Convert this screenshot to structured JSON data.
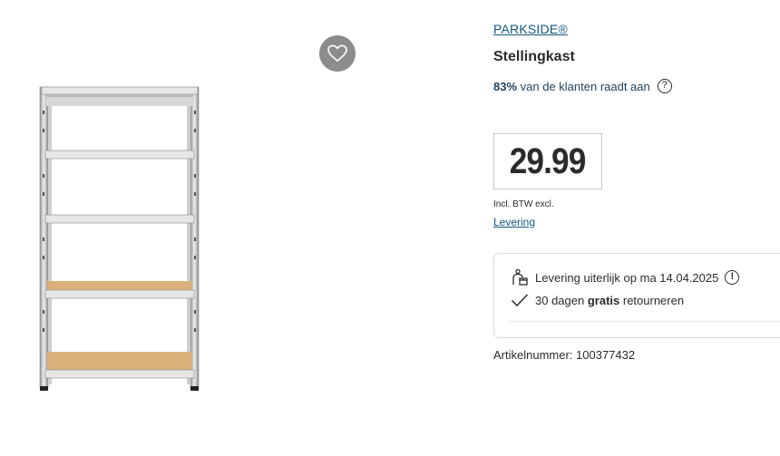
{
  "product": {
    "brand": "PARKSIDE®",
    "title": "Stellingkast",
    "recommend_percent": "83%",
    "recommend_text": " van de klanten raadt aan",
    "price": "29.99",
    "vat_note": "Incl. BTW excl.",
    "delivery_link": "Levering",
    "delivery_info": "Levering uiterlijk op ma 14.04.2025",
    "returns": {
      "pre": "30 dagen ",
      "bold": "gratis",
      "post": " retourneren"
    },
    "article_label": "Artikelnummer: ",
    "article_number": "100377432"
  },
  "icons": {
    "wishlist": "heart-icon",
    "help": "question-icon",
    "delivery": "package-delivery-icon",
    "alert": "exclamation-icon",
    "check": "checkmark-icon"
  },
  "colors": {
    "link": "#14577f",
    "wishlist_bg": "#8c8c8c"
  }
}
